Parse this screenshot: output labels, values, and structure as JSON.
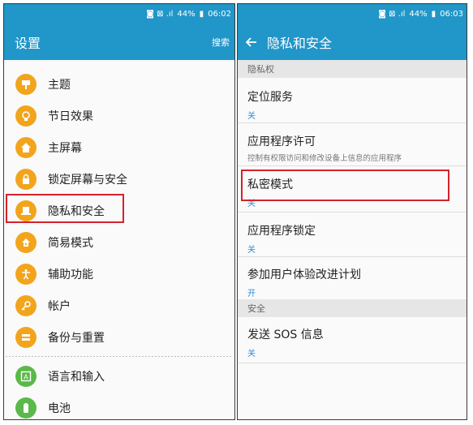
{
  "left": {
    "status": {
      "left_icons": "◙ ⊠ .ıl",
      "battery": "44%",
      "time": "06:02"
    },
    "appbar": {
      "title": "设置",
      "search": "搜索"
    },
    "items": [
      {
        "label": "主题",
        "icon": "theme-icon"
      },
      {
        "label": "节日效果",
        "icon": "lightbulb-icon"
      },
      {
        "label": "主屏幕",
        "icon": "home-icon"
      },
      {
        "label": "锁定屏幕与安全",
        "icon": "lock-icon"
      },
      {
        "label": "隐私和安全",
        "icon": "privacy-icon"
      },
      {
        "label": "简易模式",
        "icon": "easy-mode-icon"
      },
      {
        "label": "辅助功能",
        "icon": "accessibility-icon"
      },
      {
        "label": "帐户",
        "icon": "key-icon"
      },
      {
        "label": "备份与重置",
        "icon": "backup-icon"
      },
      {
        "label": "语言和输入",
        "icon": "language-icon"
      },
      {
        "label": "电池",
        "icon": "battery-icon"
      }
    ],
    "accent": "#2196c8",
    "icon_color": "#f2a51c",
    "icon_color_green": "#5ab949",
    "highlight_color": "#d4222b"
  },
  "right": {
    "status": {
      "left_icons": "◙ ⊠ .ıl",
      "battery": "44%",
      "time": "06:03"
    },
    "appbar": {
      "title": "隐私和安全"
    },
    "section_privacy": "隐私权",
    "rows": [
      {
        "title": "定位服务",
        "sub": "关"
      },
      {
        "title": "应用程序许可",
        "sub": "控制有权限访问和修改设备上信息的应用程序"
      },
      {
        "title": "私密模式",
        "sub": "关"
      },
      {
        "title": "应用程序锁定",
        "sub": "关"
      },
      {
        "title": "参加用户体验改进计划",
        "sub": "开"
      }
    ],
    "section_security": "安全",
    "sos": {
      "title": "发送 SOS 信息",
      "sub": "关"
    }
  }
}
